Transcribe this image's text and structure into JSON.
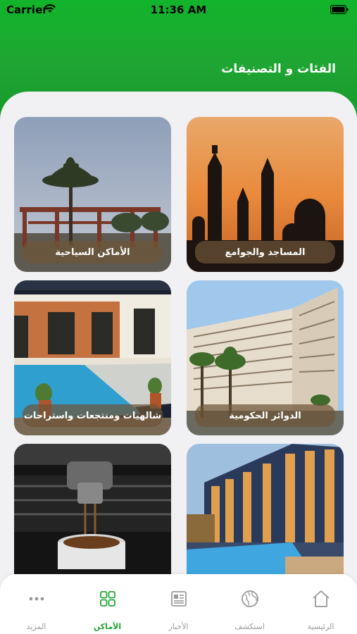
{
  "status": {
    "carrier": "Carrier",
    "time": "11:36 AM"
  },
  "header": {
    "title": "الفئات و التصنيفات"
  },
  "categories": [
    {
      "label": "المساجد والجوامع",
      "image": "mosque-silhouette-sunset"
    },
    {
      "label": "الأماكن السياحية",
      "image": "palm-tree-pergola"
    },
    {
      "label": "الدوائر الحكومية",
      "image": "government-building"
    },
    {
      "label": "شالهيات ومنتجعات واستراحات",
      "image": "resort-pool"
    },
    {
      "label": "",
      "image": "hotel-night-pool"
    },
    {
      "label": "",
      "image": "espresso-machine"
    }
  ],
  "tabbar": {
    "items": [
      {
        "label": "الرئيسية",
        "icon": "home-icon",
        "active": false
      },
      {
        "label": "استكشف",
        "icon": "globe-icon",
        "active": false
      },
      {
        "label": "الأخبار",
        "icon": "newspaper-icon",
        "active": false
      },
      {
        "label": "الأماكن",
        "icon": "grid-icon",
        "active": true
      },
      {
        "label": "المزيد",
        "icon": "more-icon",
        "active": false
      }
    ]
  },
  "colors": {
    "brand_green": "#1fa533",
    "label_bg": "#6e5537"
  }
}
